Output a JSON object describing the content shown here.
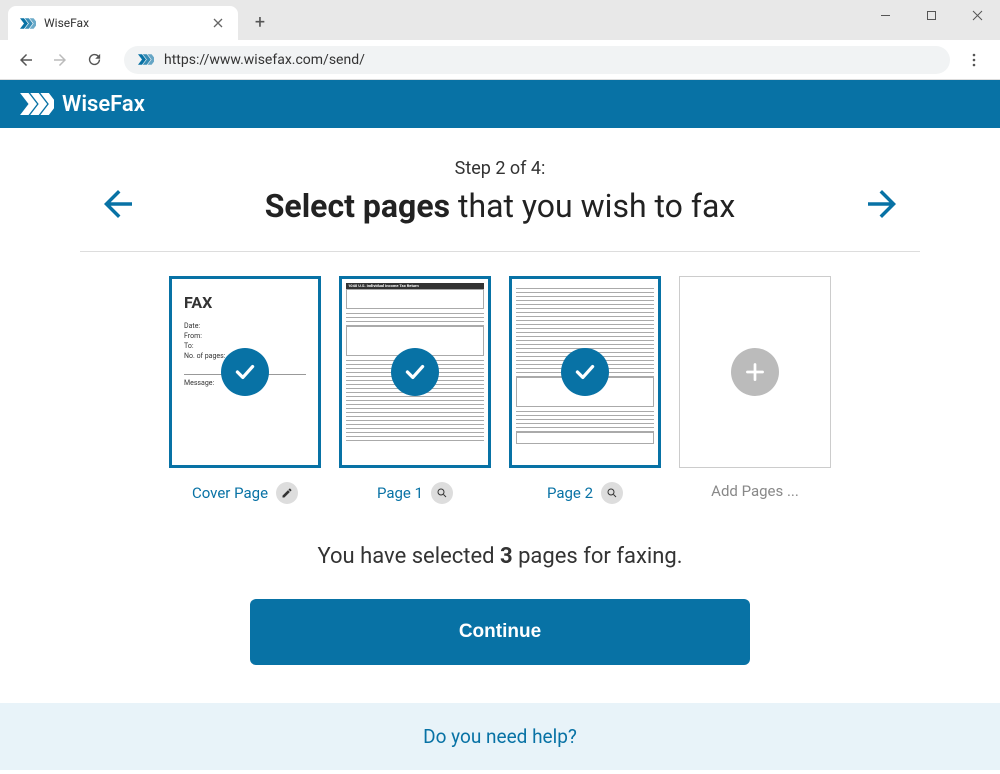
{
  "browser": {
    "tab_title": "WiseFax",
    "url": "https://www.wisefax.com/send/"
  },
  "header": {
    "brand": "WiseFax"
  },
  "step": {
    "label": "Step 2 of 4:",
    "title_strong": "Select pages",
    "title_rest": " that you wish to fax"
  },
  "pages": [
    {
      "label": "Cover Page",
      "type": "cover",
      "selected": true
    },
    {
      "label": "Page 1",
      "type": "form",
      "selected": true
    },
    {
      "label": "Page 2",
      "type": "form",
      "selected": true
    },
    {
      "label": "Add Pages ...",
      "type": "add",
      "selected": false
    }
  ],
  "cover_preview": {
    "title": "FAX",
    "fields": [
      "Date:",
      "From:",
      "To:",
      "No. of pages:",
      "Message:"
    ]
  },
  "form_preview": {
    "header1": "1040",
    "header2": "U.S. Individual Income Tax Return"
  },
  "summary": {
    "prefix": "You have selected ",
    "count": "3",
    "suffix": " pages for faxing."
  },
  "continue_label": "Continue",
  "help_label": "Do you need help?"
}
